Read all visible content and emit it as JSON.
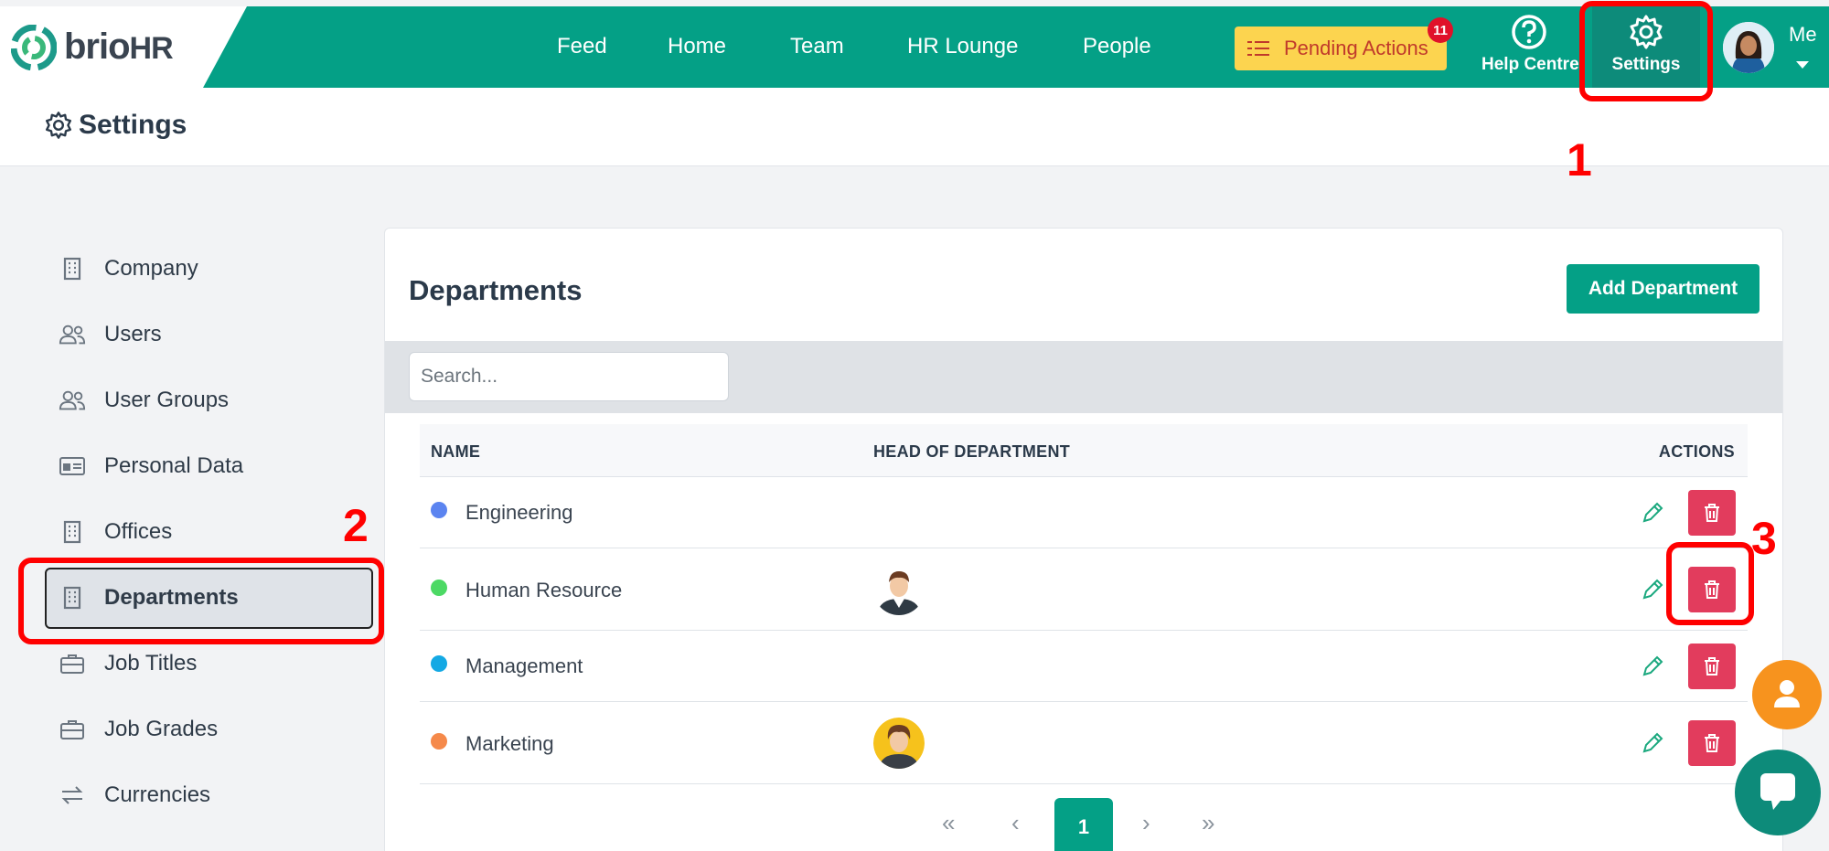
{
  "brand": {
    "name": "brio",
    "suffix": "HR"
  },
  "nav": [
    "Feed",
    "Home",
    "Team",
    "HR Lounge",
    "People"
  ],
  "pending_actions": {
    "label": "Pending Actions",
    "count": "11"
  },
  "help_label": "Help Centre",
  "settings_label": "Settings",
  "me_label": "Me",
  "page_title": "Settings",
  "sidebar": [
    {
      "label": "Company",
      "icon": "building-icon"
    },
    {
      "label": "Users",
      "icon": "users-icon"
    },
    {
      "label": "User Groups",
      "icon": "users-icon"
    },
    {
      "label": "Personal Data",
      "icon": "id-card-icon"
    },
    {
      "label": "Offices",
      "icon": "building-icon"
    },
    {
      "label": "Departments",
      "icon": "building-icon"
    },
    {
      "label": "Job Titles",
      "icon": "briefcase-icon"
    },
    {
      "label": "Job Grades",
      "icon": "briefcase-icon"
    },
    {
      "label": "Currencies",
      "icon": "exchange-icon"
    }
  ],
  "main": {
    "title": "Departments",
    "add_button": "Add Department",
    "search_placeholder": "Search...",
    "columns": [
      "NAME",
      "HEAD OF DEPARTMENT",
      "ACTIONS"
    ],
    "rows": [
      {
        "name": "Engineering",
        "color": "#5b84f0",
        "has_head": false
      },
      {
        "name": "Human Resource",
        "color": "#4cd964",
        "has_head": true
      },
      {
        "name": "Management",
        "color": "#14a9e4",
        "has_head": false
      },
      {
        "name": "Marketing",
        "color": "#f5894a",
        "has_head": true
      }
    ],
    "pagination": {
      "first": "«",
      "prev": "‹",
      "current": "1",
      "next": "›",
      "last": "»"
    }
  },
  "annotations": [
    "1",
    "2",
    "3"
  ],
  "colors": {
    "brand": "#04a086",
    "danger": "#e23c5d",
    "pending": "#fcd44f",
    "annotation": "#ff0000"
  }
}
